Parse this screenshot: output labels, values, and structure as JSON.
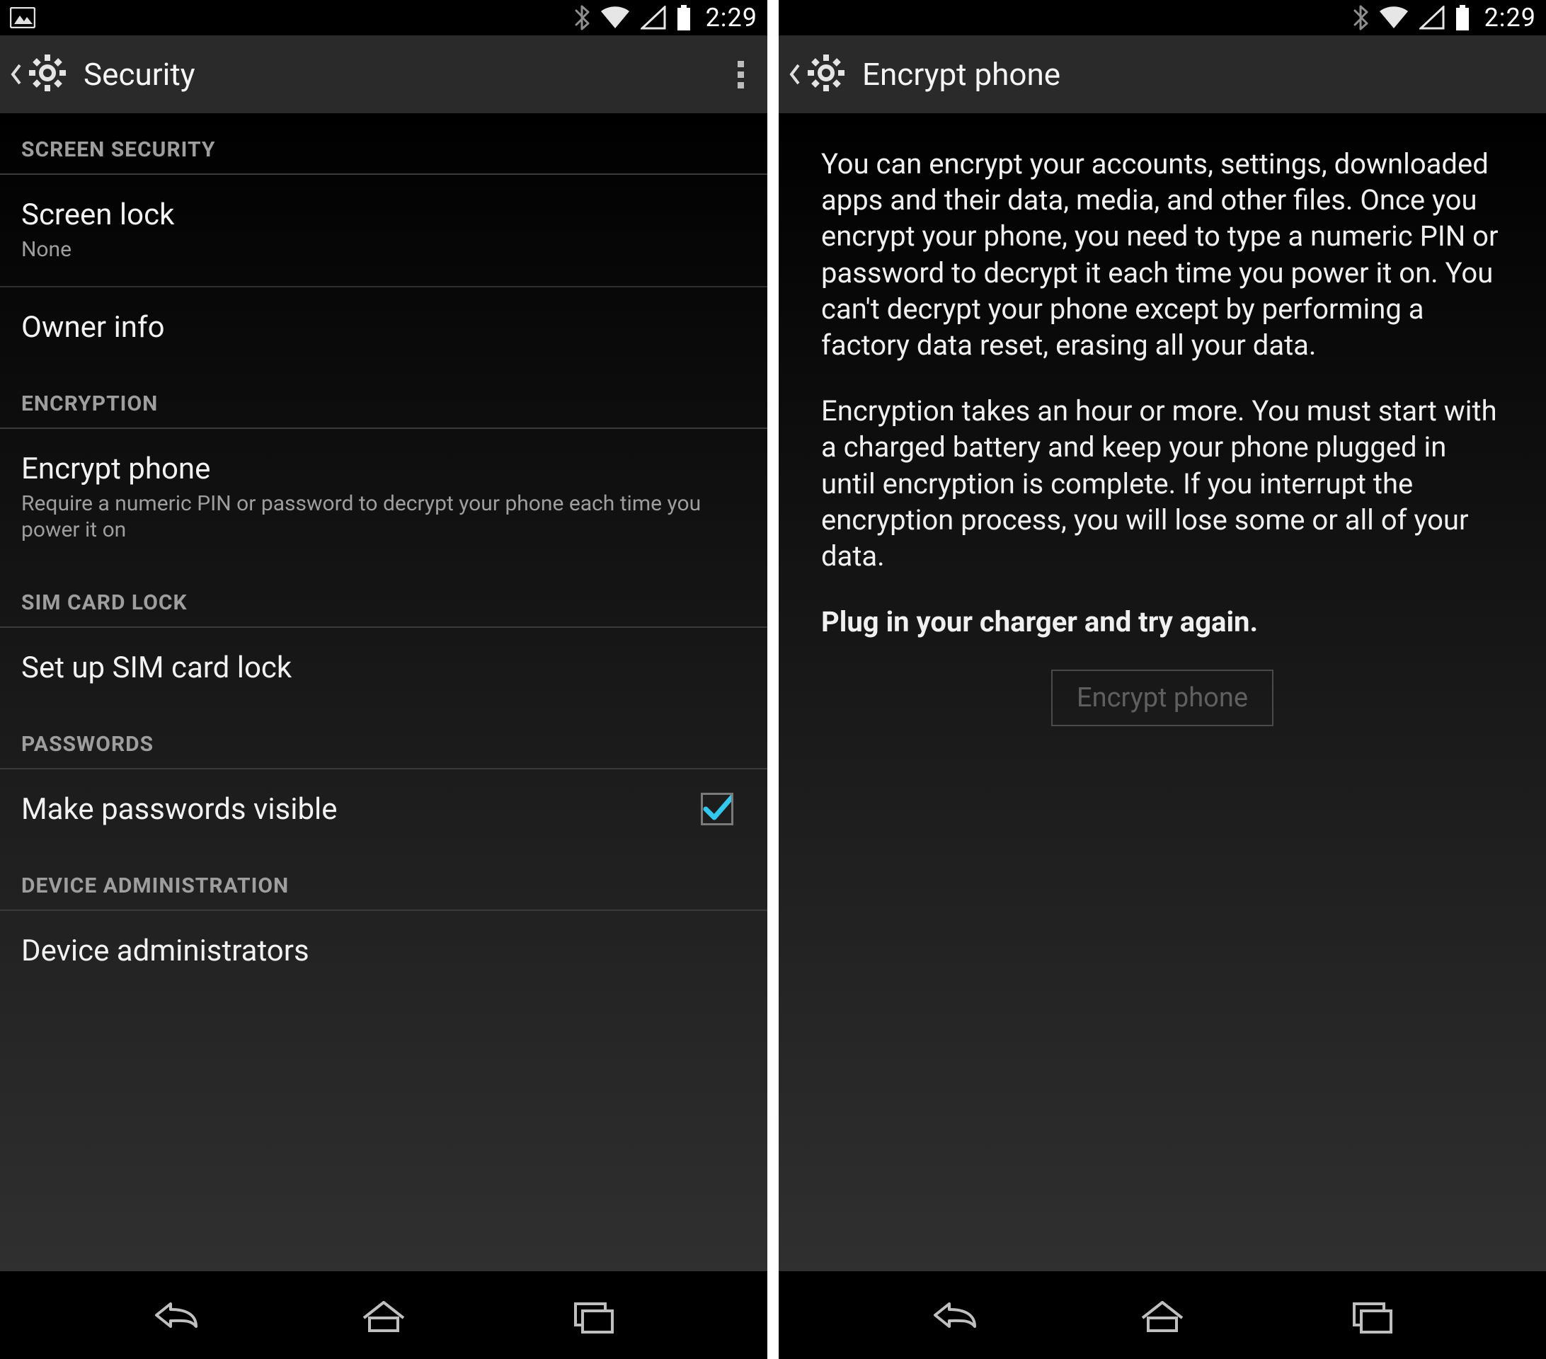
{
  "status": {
    "time": "2:29",
    "icons": {
      "image": "image-icon",
      "bluetooth": "bluetooth-icon",
      "wifi": "wifi-icon",
      "signal": "signal-icon",
      "battery": "battery-icon"
    }
  },
  "left": {
    "title": "Security",
    "sections": [
      {
        "header": "SCREEN SECURITY",
        "items": [
          {
            "title": "Screen lock",
            "sub": "None"
          },
          {
            "title": "Owner info"
          }
        ]
      },
      {
        "header": "ENCRYPTION",
        "items": [
          {
            "title": "Encrypt phone",
            "sub": "Require a numeric PIN or password to decrypt your phone each time you power it on"
          }
        ]
      },
      {
        "header": "SIM CARD LOCK",
        "items": [
          {
            "title": "Set up SIM card lock"
          }
        ]
      },
      {
        "header": "PASSWORDS",
        "items": [
          {
            "title": "Make passwords visible",
            "checked": true
          }
        ]
      },
      {
        "header": "DEVICE ADMINISTRATION",
        "items": [
          {
            "title": "Device administrators"
          }
        ]
      }
    ]
  },
  "right": {
    "title": "Encrypt phone",
    "para1": "You can encrypt your accounts, settings, downloaded apps and their data, media, and other files. Once you encrypt your phone, you need to type a numeric PIN or password to decrypt it each time you power it on. You can't decrypt your phone except by performing a factory data reset, erasing all your data.",
    "para2": "Encryption takes an hour or more. You must start with a charged battery and keep your phone plugged in until encryption is complete. If you interrupt the encryption process, you will lose some or all of your data.",
    "warn": "Plug in your charger and try again.",
    "button": "Encrypt phone",
    "button_enabled": false
  },
  "nav": {
    "back": "back-icon",
    "home": "home-icon",
    "recent": "recent-apps-icon"
  }
}
